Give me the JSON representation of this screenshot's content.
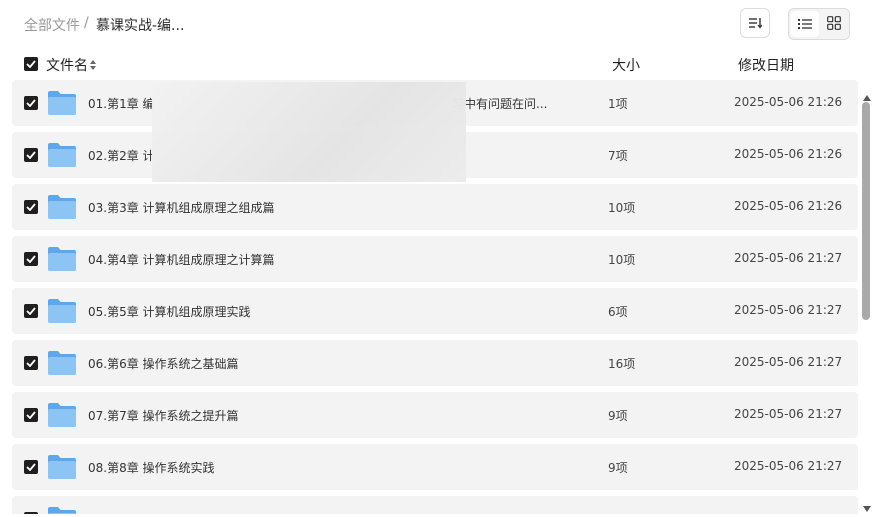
{
  "breadcrumb": {
    "root": "全部文件",
    "separator": "/",
    "current": "慕课实战-编..."
  },
  "toolbar": {
    "sort_icon": "sort-list-icon",
    "view_list_icon": "list-view-icon",
    "view_grid_icon": "grid-view-icon",
    "active_view": "list"
  },
  "table": {
    "columns": {
      "name": "文件名",
      "size": "大小",
      "date": "修改日期"
    },
    "rows": [
      {
        "name": "01.第1章 编",
        "name_tail": "习中有问题在问...",
        "size": "1项",
        "date": "2025-05-06 21:26",
        "checked": true
      },
      {
        "name": "02.第2章 计",
        "size": "7项",
        "date": "2025-05-06 21:26",
        "checked": true
      },
      {
        "name": "03.第3章 计算机组成原理之组成篇",
        "size": "10项",
        "date": "2025-05-06 21:26",
        "checked": true
      },
      {
        "name": "04.第4章 计算机组成原理之计算篇",
        "size": "10项",
        "date": "2025-05-06 21:27",
        "checked": true
      },
      {
        "name": "05.第5章 计算机组成原理实践",
        "size": "6项",
        "date": "2025-05-06 21:27",
        "checked": true
      },
      {
        "name": "06.第6章 操作系统之基础篇",
        "size": "16项",
        "date": "2025-05-06 21:27",
        "checked": true
      },
      {
        "name": "07.第7章 操作系统之提升篇",
        "size": "9项",
        "date": "2025-05-06 21:27",
        "checked": true
      },
      {
        "name": "08.第8章 操作系统实践",
        "size": "9项",
        "date": "2025-05-06 21:27",
        "checked": true
      },
      {
        "name": "",
        "size": "",
        "date": "",
        "checked": true
      }
    ]
  },
  "colors": {
    "folder": "#7fb8f0",
    "row_bg": "#f3f3f3",
    "checkbox": "#1f1f1f"
  },
  "scroll_position": 0
}
